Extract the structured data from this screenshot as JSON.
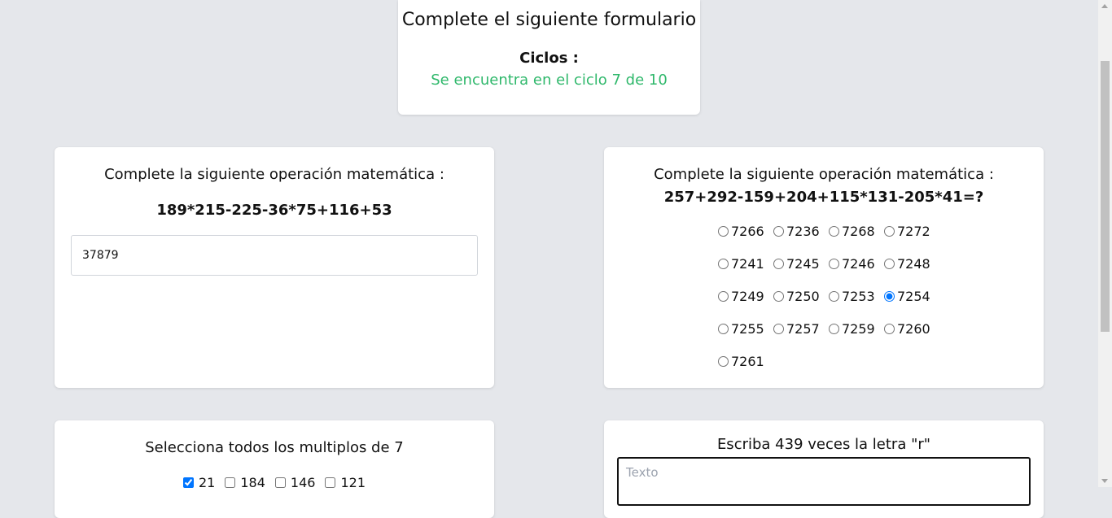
{
  "header": {
    "title": "Complete el siguiente formulario",
    "cycles_label": "Ciclos :",
    "cycles_status": "Se encuentra en el ciclo 7 de 10"
  },
  "math_input_card": {
    "prompt": "Complete la siguiente operación matemática :",
    "expression": "189*215-225-36*75+116+53",
    "answer_value": "37879"
  },
  "math_radio_card": {
    "prompt": "Complete la siguiente operación matemática :",
    "expression": "257+292-159+204+115*131-205*41=?",
    "options": [
      "7266",
      "7236",
      "7268",
      "7272",
      "7241",
      "7245",
      "7246",
      "7248",
      "7249",
      "7250",
      "7253",
      "7254",
      "7255",
      "7257",
      "7259",
      "7260",
      "7261"
    ],
    "selected": "7254"
  },
  "multiples_card": {
    "prompt": "Selecciona todos los multiplos de 7",
    "options": [
      {
        "label": "21",
        "checked": true
      },
      {
        "label": "184",
        "checked": false
      },
      {
        "label": "146",
        "checked": false
      },
      {
        "label": "121",
        "checked": false
      }
    ]
  },
  "text_card": {
    "prompt": "Escriba 439 veces la letra \"r\"",
    "placeholder": "Texto"
  },
  "colors": {
    "background": "#e5e7eb",
    "status_green": "#2fb86b",
    "card": "#ffffff"
  }
}
